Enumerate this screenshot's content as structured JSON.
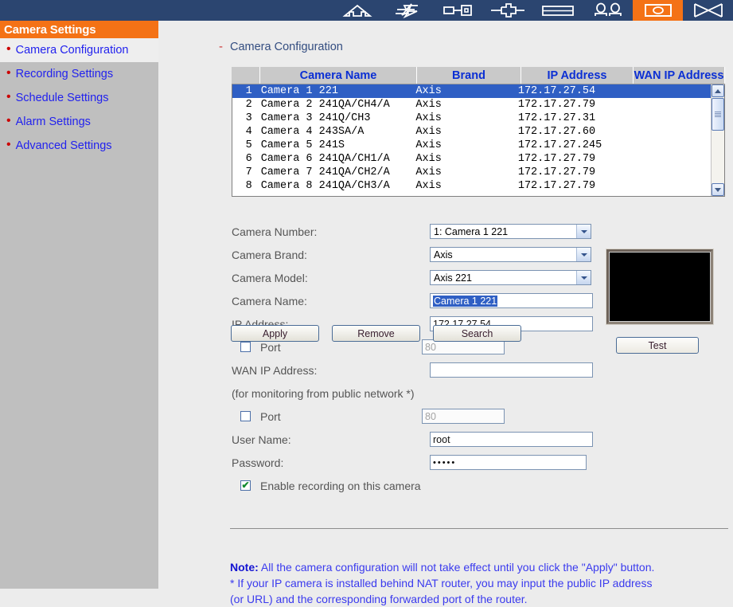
{
  "toolbar": {
    "items": [
      {
        "name": "home-icon",
        "label": "Home",
        "active": false
      },
      {
        "name": "lightning-icon",
        "label": "Live Event",
        "active": false
      },
      {
        "name": "key-icon",
        "label": "Account",
        "active": false
      },
      {
        "name": "plug-icon",
        "label": "Connection",
        "active": false
      },
      {
        "name": "storage-icon",
        "label": "Storage",
        "active": false
      },
      {
        "name": "users-icon",
        "label": "Users",
        "active": false
      },
      {
        "name": "camera-icon",
        "label": "Camera Settings",
        "active": true
      },
      {
        "name": "network-icon",
        "label": "Network",
        "active": false
      }
    ],
    "accent_color": "#f47216",
    "bar_color": "#2b4570"
  },
  "sidebar": {
    "title": "Camera Settings",
    "items": [
      {
        "label": "Camera Configuration",
        "selected": true
      },
      {
        "label": "Recording Settings",
        "selected": false
      },
      {
        "label": "Schedule Settings",
        "selected": false
      },
      {
        "label": "Alarm Settings",
        "selected": false
      },
      {
        "label": "Advanced Settings",
        "selected": false
      }
    ]
  },
  "page": {
    "heading": "Camera Configuration",
    "heading_dash": "-"
  },
  "camera_table": {
    "columns": [
      "",
      "Camera Name",
      "Brand",
      "IP Address",
      "WAN IP Address"
    ],
    "rows": [
      {
        "n": "1",
        "name": "Camera 1 221",
        "brand": "Axis",
        "ip": "172.17.27.54",
        "wan": "",
        "selected": true
      },
      {
        "n": "2",
        "name": "Camera 2 241QA/CH4/A",
        "brand": "Axis",
        "ip": "172.17.27.79",
        "wan": "",
        "selected": false
      },
      {
        "n": "3",
        "name": "Camera 3 241Q/CH3",
        "brand": "Axis",
        "ip": "172.17.27.31",
        "wan": "",
        "selected": false
      },
      {
        "n": "4",
        "name": "Camera 4 243SA/A",
        "brand": "Axis",
        "ip": "172.17.27.60",
        "wan": "",
        "selected": false
      },
      {
        "n": "5",
        "name": "Camera 5 241S",
        "brand": "Axis",
        "ip": "172.17.27.245",
        "wan": "",
        "selected": false
      },
      {
        "n": "6",
        "name": "Camera 6 241QA/CH1/A",
        "brand": "Axis",
        "ip": "172.17.27.79",
        "wan": "",
        "selected": false
      },
      {
        "n": "7",
        "name": "Camera 7 241QA/CH2/A",
        "brand": "Axis",
        "ip": "172.17.27.79",
        "wan": "",
        "selected": false
      },
      {
        "n": "8",
        "name": "Camera 8 241QA/CH3/A",
        "brand": "Axis",
        "ip": "172.17.27.79",
        "wan": "",
        "selected": false
      }
    ]
  },
  "form": {
    "camera_number": {
      "label": "Camera Number:",
      "value": "1: Camera 1 221"
    },
    "camera_brand": {
      "label": "Camera Brand:",
      "value": "Axis"
    },
    "camera_model": {
      "label": "Camera Model:",
      "value": "Axis 221"
    },
    "camera_name": {
      "label": "Camera Name:",
      "value": "Camera 1 221"
    },
    "ip_address": {
      "label": "IP Address:",
      "value": "172.17.27.54"
    },
    "lan_port": {
      "label": "Port",
      "placeholder": "80",
      "value": "",
      "checked": false
    },
    "wan_ip_address": {
      "label": "WAN IP Address:",
      "value": ""
    },
    "wan_hint": "(for monitoring from public network *)",
    "wan_port": {
      "label": "Port",
      "placeholder": "80",
      "value": "",
      "checked": false
    },
    "user_name": {
      "label": "User Name:",
      "value": "root"
    },
    "password": {
      "label": "Password:",
      "value": "•••••"
    },
    "enable_recording": {
      "label": "Enable recording on this camera",
      "checked": true
    }
  },
  "buttons": {
    "apply": "Apply",
    "remove": "Remove",
    "search": "Search",
    "test": "Test"
  },
  "note": {
    "prefix": "Note:",
    "line1": " All the camera configuration will not take effect until you click the \"Apply\" button.",
    "line2": "* If your IP camera is installed behind NAT router, you may input the public IP address",
    "line3": "(or URL) and the corresponding forwarded port of the router."
  }
}
